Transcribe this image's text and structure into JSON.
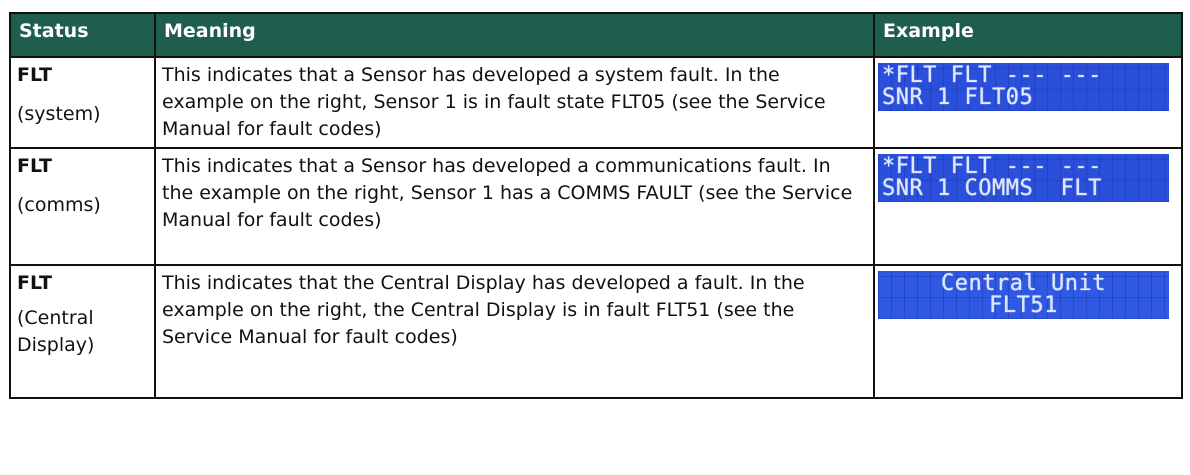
{
  "table": {
    "headers": {
      "status": "Status",
      "meaning": "Meaning",
      "example": "Example"
    },
    "rows": [
      {
        "code": "FLT",
        "sub": "(system)",
        "meaning": "This indicates that a Sensor has developed a system fault. In the example on the right, Sensor 1 is in fault state FLT05 (see the Service Manual for fault codes)",
        "display_lines": [
          "*FLT FLT --- ---",
          "SNR 1 FLT05"
        ]
      },
      {
        "code": "FLT",
        "sub": "(comms)",
        "meaning": "This indicates that a Sensor has developed a communications fault. In the example on the right, Sensor 1 has a COMMS FAULT (see the Service Manual for fault codes)",
        "display_lines": [
          "*FLT FLT --- ---",
          "SNR 1 COMMS  FLT"
        ]
      },
      {
        "code": "FLT",
        "sub": "(Central Display)",
        "meaning": "This indicates that the Central Display has developed a fault. In the example on the right, the Central Display is in fault FLT51 (see the Service Manual for fault codes)",
        "display_lines": [
          "Central Unit",
          "FLT51"
        ]
      }
    ]
  },
  "colors": {
    "header_bg": "#1f5d4c",
    "header_text": "#ffffff",
    "lcd_bg": "#2a4fdb",
    "lcd_text": "#dfe8ff"
  }
}
